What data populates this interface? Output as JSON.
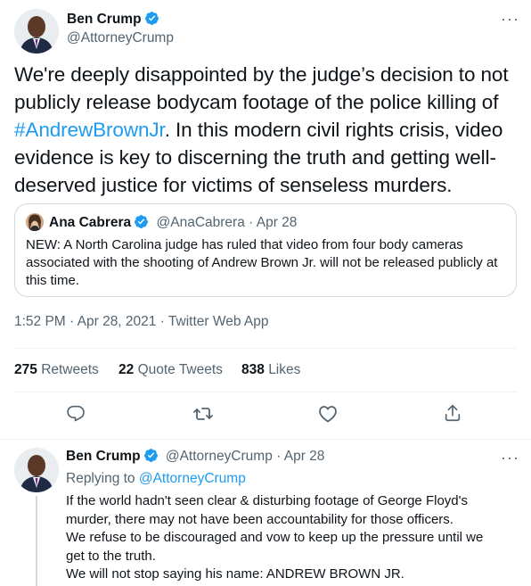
{
  "main_tweet": {
    "author_name": "Ben Crump",
    "author_handle": "@AttorneyCrump",
    "more_icon": "ellipsis-icon",
    "text_before": "We're deeply disappointed by the judge’s decision to not publicly release bodycam footage of the police killing of ",
    "hashtag": "#AndrewBrownJr",
    "text_after": ". In this modern civil rights crisis, video evidence is key to discerning the truth and getting well-deserved justice for victims of senseless murders.",
    "quote": {
      "author_name": "Ana Cabrera",
      "author_handle": "@AnaCabrera",
      "separator": " · ",
      "date": "Apr 28",
      "text": "NEW: A North Carolina judge has ruled that video from four body cameras associated with the shooting of Andrew Brown Jr. will not be released publicly at this time."
    },
    "timestamp": "1:52 PM · Apr 28, 2021 · Twitter Web App",
    "stats": {
      "retweets_count": "275",
      "retweets_label": "Retweets",
      "quotes_count": "22",
      "quotes_label": "Quote Tweets",
      "likes_count": "838",
      "likes_label": "Likes"
    },
    "actions": [
      "reply-icon",
      "retweet-icon",
      "like-icon",
      "share-icon"
    ]
  },
  "reply_tweet": {
    "author_name": "Ben Crump",
    "author_handle": "@AttorneyCrump",
    "separator": " · ",
    "date": "Apr 28",
    "replying_label": "Replying to ",
    "replying_to": "@AttorneyCrump",
    "lines": [
      "If the world hadn't seen clear & disturbing footage of George Floyd's",
      "murder, there may not have been accountability for those officers.",
      "We refuse to be discouraged and vow to keep up the pressure until we",
      "get to the truth.",
      "We will not stop saying his name: ANDREW BROWN JR."
    ]
  },
  "colors": {
    "link_blue": "#1d9bf0",
    "secondary_text": "#536471",
    "primary_text": "#0f1419",
    "border": "#cfd9de"
  }
}
